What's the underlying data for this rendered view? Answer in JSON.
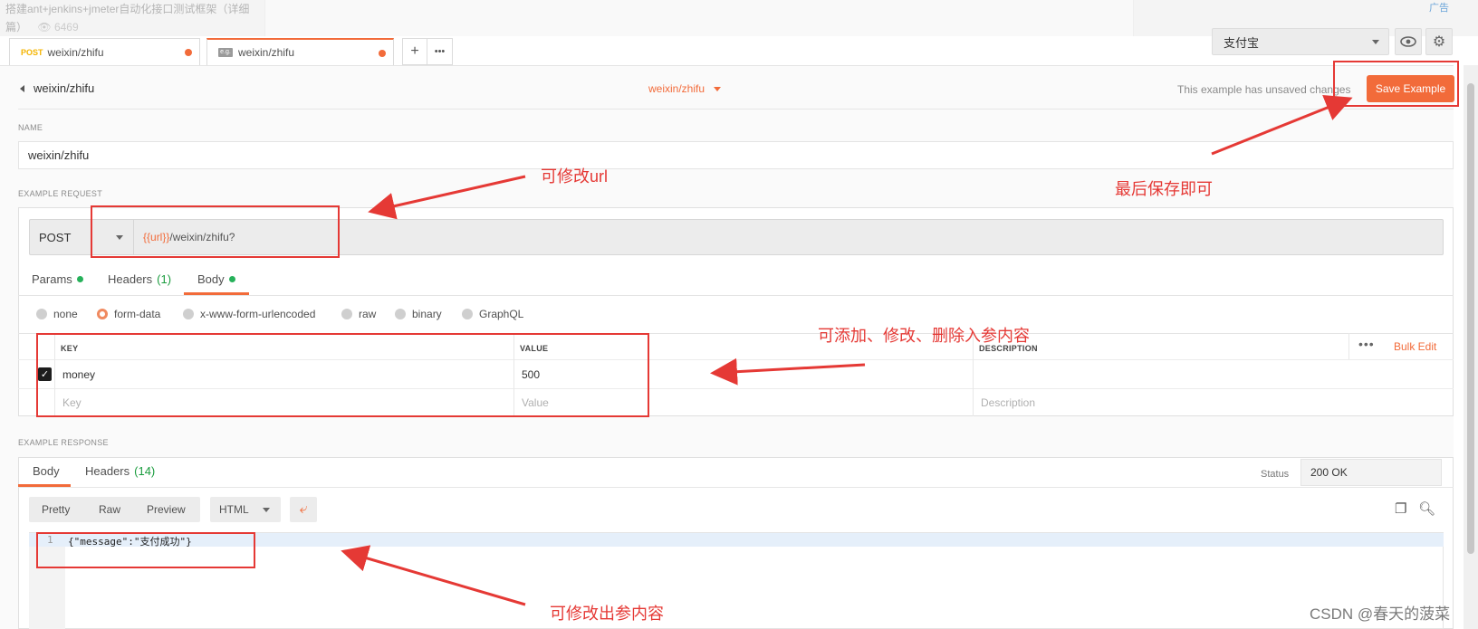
{
  "background": {
    "article_title": "搭建ant+jenkins+jmeter自动化接口测试框架（详细篇）",
    "views": "6469",
    "ad_label": "广告"
  },
  "tabs": [
    {
      "method": "POST",
      "label": "weixin/zhifu",
      "unsaved": true
    },
    {
      "method": "",
      "icon": "example-icon",
      "label": "weixin/zhifu",
      "unsaved": true,
      "active": true
    }
  ],
  "tab_actions": {
    "add": "+",
    "more": "•••"
  },
  "environment": {
    "selected": "支付宝",
    "quick_look_icon": "eye-icon",
    "settings_icon": "gear-icon"
  },
  "header": {
    "back_label": "weixin/zhifu",
    "request_name": "weixin/zhifu",
    "unsaved_text": "This example has unsaved changes",
    "save_button": "Save Example"
  },
  "name_section": {
    "label": "NAME",
    "value": "weixin/zhifu"
  },
  "request_section": {
    "label": "EXAMPLE REQUEST",
    "method": "POST",
    "url_var": "{{url}}",
    "url_path": "/weixin/zhifu?"
  },
  "request_tabs": [
    {
      "label": "Params",
      "count": "",
      "dot": true
    },
    {
      "label": "Headers",
      "count": "(1)",
      "dot": false
    },
    {
      "label": "Body",
      "count": "",
      "dot": true,
      "active": true
    }
  ],
  "body_modes": [
    {
      "label": "none",
      "selected": false
    },
    {
      "label": "form-data",
      "selected": true
    },
    {
      "label": "x-www-form-urlencoded",
      "selected": false
    },
    {
      "label": "raw",
      "selected": false
    },
    {
      "label": "binary",
      "selected": false
    },
    {
      "label": "GraphQL",
      "selected": false
    }
  ],
  "form_table": {
    "headers": {
      "key": "KEY",
      "value": "VALUE",
      "description": "DESCRIPTION"
    },
    "rows": [
      {
        "checked": true,
        "key": "money",
        "value": "500",
        "description": ""
      }
    ],
    "placeholder": {
      "key": "Key",
      "value": "Value",
      "description": "Description"
    },
    "more": "•••",
    "bulk_edit": "Bulk Edit"
  },
  "response_section": {
    "label": "EXAMPLE RESPONSE",
    "tabs": [
      {
        "label": "Body",
        "count": "",
        "active": true
      },
      {
        "label": "Headers",
        "count": "(14)"
      }
    ],
    "status_label": "Status",
    "status_value": "200 OK",
    "view_modes": [
      "Pretty",
      "Raw",
      "Preview"
    ],
    "language": "HTML",
    "line_number": "1",
    "code": "{\"message\":\"支付成功\"}"
  },
  "annotations": {
    "url": "可修改url",
    "save": "最后保存即可",
    "params": "可添加、修改、删除入参内容",
    "response": "可修改出参内容"
  },
  "watermark": "CSDN @春天的菠菜",
  "colors": {
    "accent": "#f26b3a",
    "annotation": "#e53935",
    "dot_green": "#26b15a"
  }
}
